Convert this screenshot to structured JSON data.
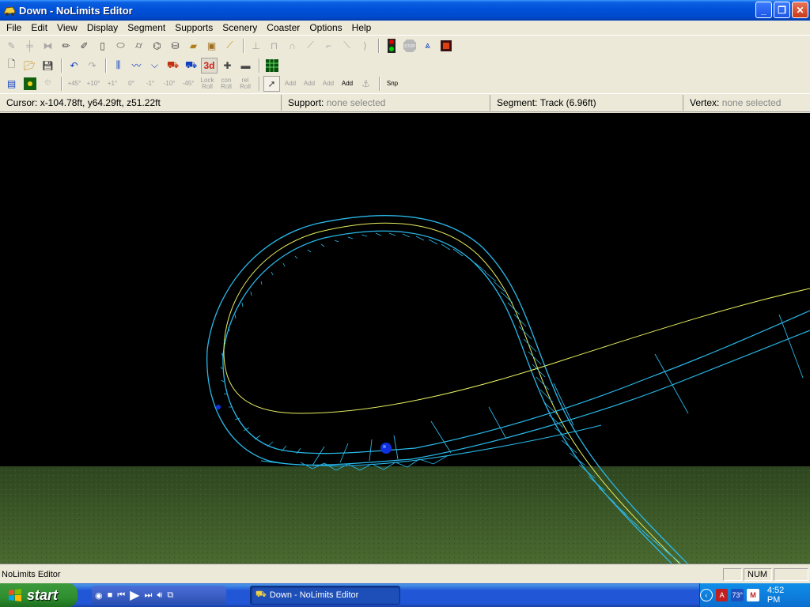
{
  "window": {
    "title": "Down - NoLimits Editor",
    "icon": "coaster-car-icon",
    "buttons": [
      "minimize",
      "maximize",
      "close"
    ]
  },
  "menu": [
    "File",
    "Edit",
    "View",
    "Display",
    "Segment",
    "Supports",
    "Scenery",
    "Coaster",
    "Options",
    "Help"
  ],
  "toolbar3": {
    "angles": [
      "+45°",
      "+10°",
      "+1°",
      "0°",
      "-1°",
      "-10°",
      "-45°"
    ],
    "lock_roll": "Lock Roll",
    "con_roll": "con Roll",
    "rel_roll": "rel Roll",
    "add": "Add",
    "snap": "Snp"
  },
  "toolbar2": {
    "view3d": "3d"
  },
  "infobar": {
    "cursor_label": "Cursor:",
    "cursor_value": "x-104.78ft, y64.29ft, z51.22ft",
    "support_label": "Support:",
    "support_value": "none selected",
    "segment_label": "Segment:",
    "segment_value": "Track (6.96ft)",
    "vertex_label": "Vertex:",
    "vertex_value": "none selected"
  },
  "statusbar": {
    "text": "NoLimits Editor",
    "num": "NUM"
  },
  "taskbar": {
    "start": "start",
    "task_item": "Down - NoLimits Editor",
    "temperature": "73°",
    "clock": "4:52 PM"
  },
  "colors": {
    "track_wire": "#29b8e8",
    "heartline": "#e8f060",
    "ground": "#3a5228",
    "sky": "#000000",
    "vertex": "#1030e0"
  }
}
